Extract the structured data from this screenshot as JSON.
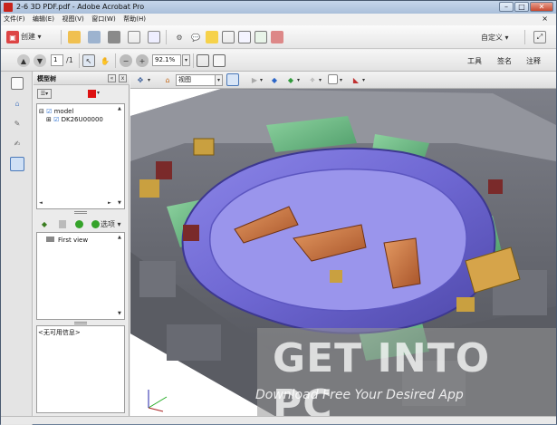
{
  "window": {
    "title": "2-6 3D PDF.pdf - Adobe Acrobat Pro",
    "minimize": "–",
    "maximize": "□",
    "close": "✕"
  },
  "menu": {
    "items": [
      "文件(F)",
      "编辑(E)",
      "视图(V)",
      "窗口(W)",
      "帮助(H)"
    ],
    "close_doc": "×"
  },
  "toolbar": {
    "create_label": "创建",
    "customize_label": "自定义",
    "page_current": "1",
    "page_total": "/1",
    "zoom_value": "92.1%",
    "tools_label": "工具",
    "sign_label": "签名",
    "comment_label": "注释"
  },
  "panel": {
    "title": "模型树",
    "tree": {
      "root": "model",
      "child": "DK26U00000"
    },
    "options_label": "选项",
    "view_item": "First view",
    "info_label": "<无可用信息>"
  },
  "viewport": {
    "view_label": "视图"
  },
  "watermark": {
    "line1": "GET INTO PC",
    "line2": "Download Free Your Desired App"
  }
}
